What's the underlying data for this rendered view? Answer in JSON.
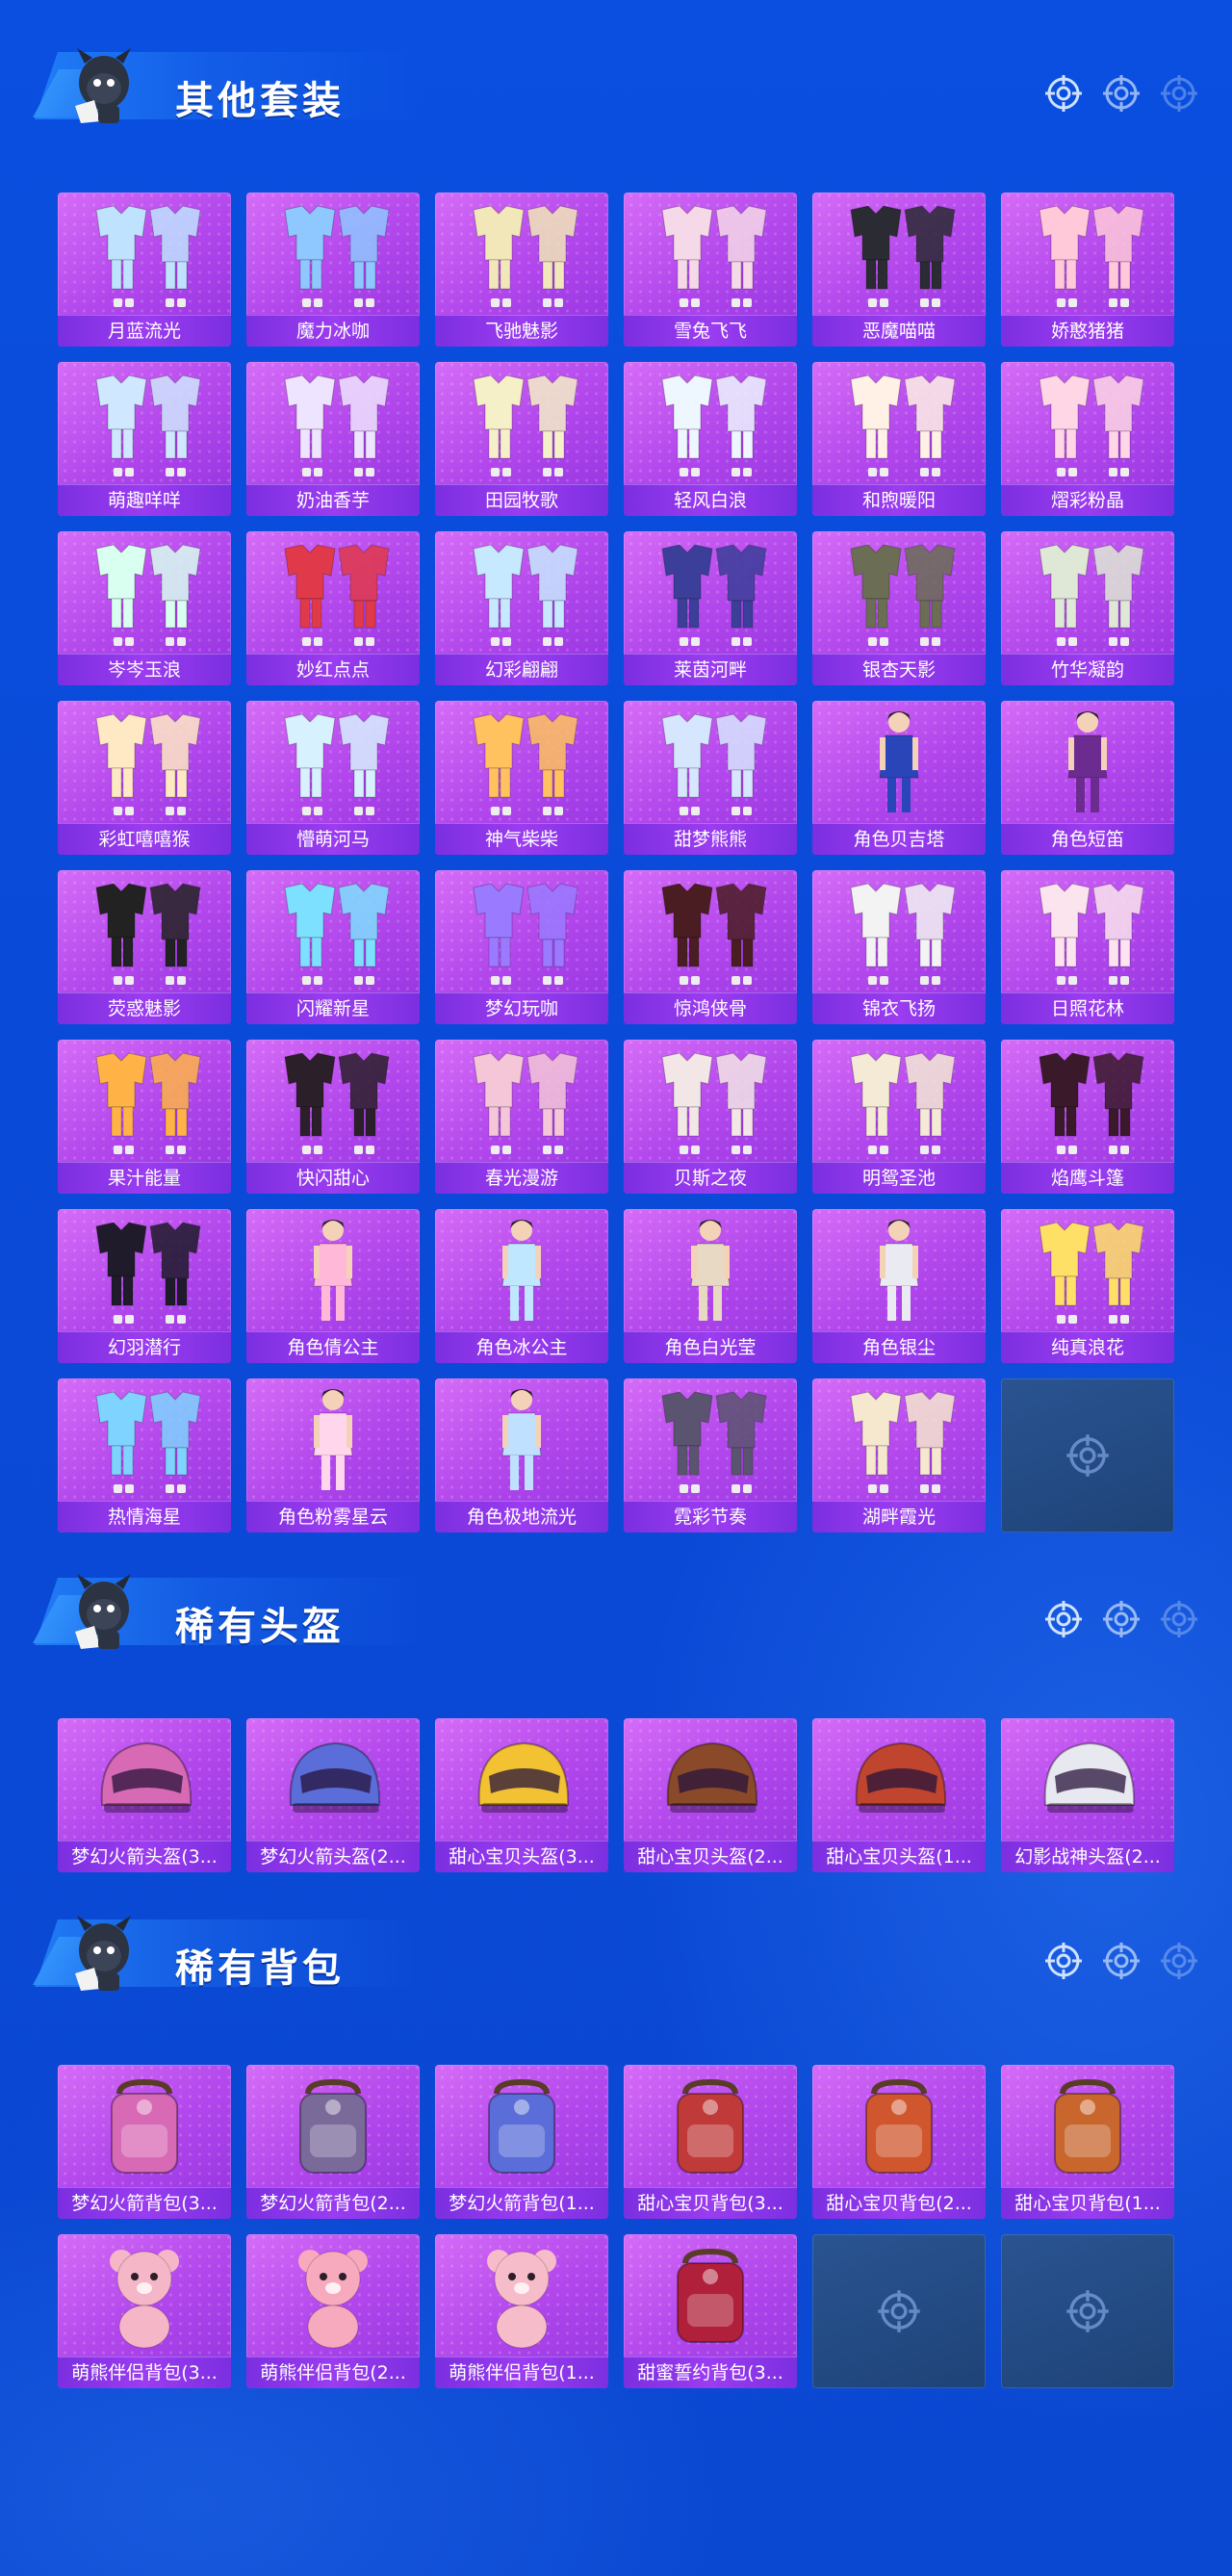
{
  "sections": [
    {
      "title": "其他套装",
      "items": [
        {
          "label": "月蓝流光",
          "kind": "outfit",
          "color": "#bfe3ff"
        },
        {
          "label": "魔力冰咖",
          "kind": "outfit",
          "color": "#8fc7ff"
        },
        {
          "label": "飞驰魅影",
          "kind": "outfit",
          "color": "#f1e7b8"
        },
        {
          "label": "雪兔飞飞",
          "kind": "outfit",
          "color": "#f6d9e8"
        },
        {
          "label": "恶魔喵喵",
          "kind": "outfit",
          "color": "#2b2b33"
        },
        {
          "label": "娇憨猪猪",
          "kind": "outfit",
          "color": "#ffc9da"
        },
        {
          "label": "萌趣咩咩",
          "kind": "outfit",
          "color": "#cfe7ff"
        },
        {
          "label": "奶油香芋",
          "kind": "outfit",
          "color": "#efe4ff"
        },
        {
          "label": "田园牧歌",
          "kind": "outfit",
          "color": "#f5f0c8"
        },
        {
          "label": "轻风白浪",
          "kind": "outfit",
          "color": "#eef6ff"
        },
        {
          "label": "和煦暖阳",
          "kind": "outfit",
          "color": "#fff1e6"
        },
        {
          "label": "熠彩粉晶",
          "kind": "outfit",
          "color": "#ffd6e6"
        },
        {
          "label": "岑岑玉浪",
          "kind": "outfit",
          "color": "#d9fff1"
        },
        {
          "label": "妙红点点",
          "kind": "outfit",
          "color": "#e0394a"
        },
        {
          "label": "幻彩翩翩",
          "kind": "outfit",
          "color": "#c7e9ff"
        },
        {
          "label": "莱茵河畔",
          "kind": "outfit",
          "color": "#3b3f9a"
        },
        {
          "label": "银杏天影",
          "kind": "outfit",
          "color": "#6b6e55"
        },
        {
          "label": "竹华凝韵",
          "kind": "outfit",
          "color": "#dfe8d6"
        },
        {
          "label": "彩虹嘻嘻猴",
          "kind": "outfit",
          "color": "#ffe9c4"
        },
        {
          "label": "懵萌河马",
          "kind": "outfit",
          "color": "#d8f1ff"
        },
        {
          "label": "神气柴柴",
          "kind": "outfit",
          "color": "#ffc25e"
        },
        {
          "label": "甜梦熊熊",
          "kind": "outfit",
          "color": "#d7e6ff"
        },
        {
          "label": "角色贝吉塔",
          "kind": "character",
          "color": "#2a45b8"
        },
        {
          "label": "角色短笛",
          "kind": "character",
          "color": "#6b2b8f"
        },
        {
          "label": "荧惑魅影",
          "kind": "outfit",
          "color": "#222"
        },
        {
          "label": "闪耀新星",
          "kind": "outfit",
          "color": "#7ee0ff"
        },
        {
          "label": "梦幻玩咖",
          "kind": "outfit",
          "color": "#9a7bff"
        },
        {
          "label": "惊鸿侠骨",
          "kind": "outfit",
          "color": "#4a1d22"
        },
        {
          "label": "锦衣飞扬",
          "kind": "outfit",
          "color": "#f3f3f3"
        },
        {
          "label": "日照花林",
          "kind": "outfit",
          "color": "#fbe4ee"
        },
        {
          "label": "果汁能量",
          "kind": "outfit",
          "color": "#ffb347"
        },
        {
          "label": "快闪甜心",
          "kind": "outfit",
          "color": "#2b1f2a"
        },
        {
          "label": "春光漫游",
          "kind": "outfit",
          "color": "#f4c6d8"
        },
        {
          "label": "贝斯之夜",
          "kind": "outfit",
          "color": "#f3e6e6"
        },
        {
          "label": "明鸳圣池",
          "kind": "outfit",
          "color": "#f5ead5"
        },
        {
          "label": "焰鹰斗篷",
          "kind": "outfit",
          "color": "#3a1a2a"
        },
        {
          "label": "幻羽潜行",
          "kind": "outfit",
          "color": "#1f1b2b"
        },
        {
          "label": "角色倩公主",
          "kind": "character",
          "color": "#ffb8d8"
        },
        {
          "label": "角色冰公主",
          "kind": "character",
          "color": "#bfe7ff"
        },
        {
          "label": "角色白光莹",
          "kind": "character",
          "color": "#e8d9c4"
        },
        {
          "label": "角色银尘",
          "kind": "character",
          "color": "#eaeaf2"
        },
        {
          "label": "纯真浪花",
          "kind": "outfit",
          "color": "#ffe066"
        },
        {
          "label": "热情海星",
          "kind": "outfit",
          "color": "#7fd4ff"
        },
        {
          "label": "角色粉雾星云",
          "kind": "character",
          "color": "#ffd6ec"
        },
        {
          "label": "角色极地流光",
          "kind": "character",
          "color": "#bfe0ff"
        },
        {
          "label": "霓彩节奏",
          "kind": "outfit",
          "color": "#5b5470"
        },
        {
          "label": "湖畔霞光",
          "kind": "outfit",
          "color": "#f6e7cf"
        },
        {
          "label": "",
          "kind": "empty",
          "color": ""
        }
      ]
    },
    {
      "title": "稀有头盔",
      "items": [
        {
          "label": "梦幻火箭头盔(3...",
          "kind": "helmet",
          "color": "#d86ab5"
        },
        {
          "label": "梦幻火箭头盔(2...",
          "kind": "helmet",
          "color": "#5a6dd8"
        },
        {
          "label": "甜心宝贝头盔(3...",
          "kind": "helmet",
          "color": "#f2c233"
        },
        {
          "label": "甜心宝贝头盔(2...",
          "kind": "helmet",
          "color": "#8a4a2a"
        },
        {
          "label": "甜心宝贝头盔(1...",
          "kind": "helmet",
          "color": "#c0452e"
        },
        {
          "label": "幻影战神头盔(2...",
          "kind": "helmet",
          "color": "#e8e8f0"
        }
      ]
    },
    {
      "title": "稀有背包",
      "items": [
        {
          "label": "梦幻火箭背包(3...",
          "kind": "backpack",
          "color": "#d86ab5"
        },
        {
          "label": "梦幻火箭背包(2...",
          "kind": "backpack",
          "color": "#7a6a9a"
        },
        {
          "label": "梦幻火箭背包(1...",
          "kind": "backpack",
          "color": "#5a6dd8"
        },
        {
          "label": "甜心宝贝背包(3...",
          "kind": "backpack",
          "color": "#c03a3a"
        },
        {
          "label": "甜心宝贝背包(2...",
          "kind": "backpack",
          "color": "#d0562e"
        },
        {
          "label": "甜心宝贝背包(1...",
          "kind": "backpack",
          "color": "#c9662e"
        },
        {
          "label": "萌熊伴侣背包(3...",
          "kind": "bear",
          "color": "#f5b6c8"
        },
        {
          "label": "萌熊伴侣背包(2...",
          "kind": "bear",
          "color": "#f7a9bd"
        },
        {
          "label": "萌熊伴侣背包(1...",
          "kind": "bear",
          "color": "#f7bcc9"
        },
        {
          "label": "甜蜜誓约背包(3...",
          "kind": "backpack",
          "color": "#b0203a"
        },
        {
          "label": "",
          "kind": "empty",
          "color": ""
        },
        {
          "label": "",
          "kind": "empty",
          "color": ""
        }
      ]
    }
  ]
}
